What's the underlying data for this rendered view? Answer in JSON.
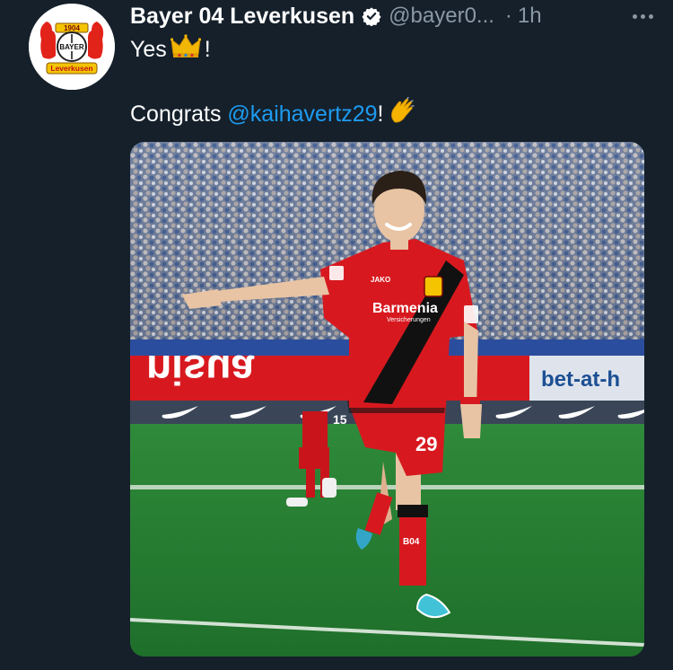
{
  "tweet": {
    "display_name": "Bayer 04 Leverkusen",
    "handle": "@bayer0...",
    "separator": "·",
    "time": "1h",
    "line1_text": "Yes",
    "line1_suffix": "!",
    "line2_prefix": "Congrats",
    "mention": "@kaihavertz29",
    "line2_suffix": "!",
    "verified": true
  },
  "avatar": {
    "year": "1904",
    "letters": "BAYER",
    "banner": "Leverkusen"
  },
  "media": {
    "description_icons": [
      "crown-emoji",
      "clapping-hands-emoji"
    ],
    "board_left": "nisua",
    "board_right": "bet-at-h",
    "shirt_sponsor": "Barmenia",
    "shirt_sponsor_sub": "Versicherungen",
    "shorts_number": "29",
    "sock_text": "B04",
    "shirt_brand": "JAKO",
    "background_player_number": "15"
  },
  "colors": {
    "background": "#15202b",
    "text": "#ffffff",
    "secondary": "#8b98a5",
    "link": "#1d9bf0",
    "verified": "#ffffff",
    "kit_red": "#d7191f"
  }
}
